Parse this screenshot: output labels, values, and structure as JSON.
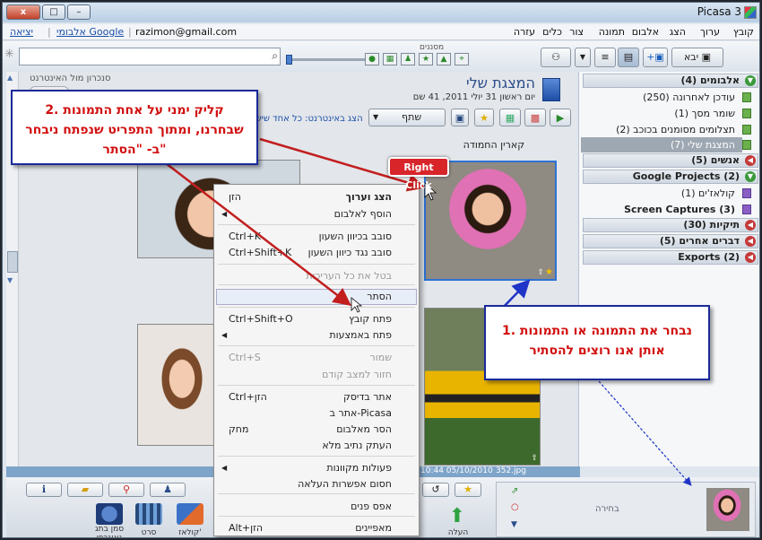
{
  "window": {
    "title": "Picasa 3",
    "controls": {
      "close": "x",
      "maximize": "□",
      "minimize": "–"
    }
  },
  "menu": [
    "קובץ",
    "ערוך",
    "הצג",
    "אלבום",
    "תמונה",
    "צור",
    "כלים",
    "עזרה"
  ],
  "account": {
    "logout": "יציאה",
    "google_albums": "אלבומי Google",
    "email": "razimon@gmail.com"
  },
  "toolbar": {
    "filters_label": "מסננים",
    "import_label": "יבא",
    "search_placeholder": ""
  },
  "album": {
    "title": "המצגת שלי",
    "date": "יום ראשון 31 יולי 2011, 41 שם",
    "sync_label": "סנכרון מול האינטרנט",
    "share_label": "שתף",
    "online_note": "הצג באינטרנט: כל אחד שיש לו",
    "caption": "קארין החמודה"
  },
  "sidebar": {
    "albums_header": "אלבומים (4)",
    "albums": [
      "עודכן לאחרונה (250)",
      "שומר מסך (1)",
      "תצלומים מסומנים בכוכב (2)",
      "המצגת שלי (7)"
    ],
    "people_header": "אנשים (5)",
    "google_projects_header": "Google Projects (2)",
    "google_projects": [
      "קולאז'ים (1)",
      "Screen Captures (3)"
    ],
    "folders_header": "תיקיות (30)",
    "other_header": "דברים אחרים (5)",
    "exports_header": "Exports (2)"
  },
  "context_menu": {
    "items": [
      {
        "label": "הצג וערוך",
        "shortcut": "הזן",
        "bold": true
      },
      {
        "label": "הוסף לאלבום",
        "shortcut": "",
        "arrow": true
      },
      {
        "label": "סובב בכיוון השעון",
        "shortcut": "Ctrl+K"
      },
      {
        "label": "סובב נגד כיוון השעון",
        "shortcut": "Ctrl+Shift+K"
      },
      {
        "label": "בטל את כל העריכות",
        "shortcut": "",
        "disabled": true
      },
      {
        "label": "הסתר",
        "shortcut": ""
      },
      {
        "label": "פתח קובץ",
        "shortcut": "Ctrl+Shift+O"
      },
      {
        "label": "פתח באמצעות",
        "shortcut": "",
        "arrow": true
      },
      {
        "label": "שמור",
        "shortcut": "Ctrl+S",
        "disabled": true
      },
      {
        "label": "חזור למצב קודם",
        "shortcut": "",
        "disabled": true
      },
      {
        "label": "אתר בדיסק",
        "shortcut": "Ctrl+הזן"
      },
      {
        "label": "אתר ב-Picasa",
        "shortcut": ""
      },
      {
        "label": "הסר מאלבום",
        "shortcut": "מחק"
      },
      {
        "label": "העתק נתיב מלא",
        "shortcut": ""
      },
      {
        "label": "פעולות מקוונות",
        "shortcut": "",
        "arrow": true
      },
      {
        "label": "חסום אפשרות העלאה",
        "shortcut": ""
      },
      {
        "label": "אפס פנים",
        "shortcut": ""
      },
      {
        "label": "מאפיינים",
        "shortcut": "Alt+הזן"
      }
    ]
  },
  "status": {
    "datetime": "10:44 05/10/2010",
    "filename": "352.jpg"
  },
  "bottom": {
    "selection_label": "בחירה",
    "upload_label": "העלה",
    "collage": "קולאז'",
    "movie": "סרט",
    "geotag": "סמן בתג גאוגרפי"
  },
  "annotations": {
    "step1": "1. נבחר את התמונה או התמונות אותן אנו רוצים להסתיר",
    "step2": "2. קליק ימני על אחת התמונות שבחרנו, ומתוך התפריט שנפתח ניבחר ב- \"הסתר\"",
    "right_click": "Right Click"
  },
  "colors": {
    "red_arrow": "#c21e1e",
    "blue_arrow": "#1f35c8",
    "selection_border": "#2d73d6"
  }
}
